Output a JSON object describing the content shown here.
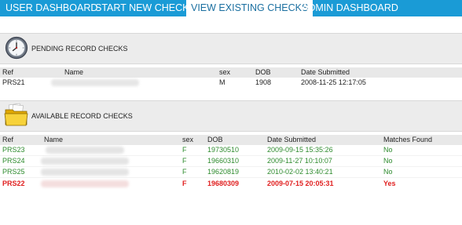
{
  "nav": {
    "tabs": [
      {
        "label": "USER DASHBOARD",
        "active": false
      },
      {
        "label": "START NEW CHECK",
        "active": false
      },
      {
        "label": "VIEW EXISTING CHECKS",
        "active": true
      },
      {
        "label": "ADMIN DASHBOARD",
        "active": false
      }
    ]
  },
  "pending": {
    "title": "PENDING RECORD CHECKS",
    "icon": "clock-icon",
    "columns": {
      "ref": "Ref",
      "name": "Name",
      "sex": "sex",
      "dob": "DOB",
      "date_submitted": "Date Submitted"
    },
    "rows": [
      {
        "ref": "PRS21",
        "sex": "M",
        "dob": "1908",
        "date_submitted": "2008-11-25 12:17:05"
      }
    ]
  },
  "available": {
    "title": "AVAILABLE RECORD CHECKS",
    "icon": "folder-icon",
    "columns": {
      "ref": "Ref",
      "name": "Name",
      "sex": "sex",
      "dob": "DOB",
      "date_submitted": "Date Submitted",
      "matches_found": "Matches Found"
    },
    "rows": [
      {
        "ref": "PRS23",
        "sex": "F",
        "dob": "19730510",
        "date_submitted": "2009-09-15 15:35:26",
        "matches_found": "No"
      },
      {
        "ref": "PRS24",
        "sex": "F",
        "dob": "19660310",
        "date_submitted": "2009-11-27 10:10:07",
        "matches_found": "No"
      },
      {
        "ref": "PRS25",
        "sex": "F",
        "dob": "19620819",
        "date_submitted": "2010-02-02 13:40:21",
        "matches_found": "No"
      },
      {
        "ref": "PRS22",
        "sex": "F",
        "dob": "19680309",
        "date_submitted": "2009-07-15 20:05:31",
        "matches_found": "Yes"
      }
    ]
  },
  "colors": {
    "nav_bg": "#1a9bd6",
    "match_no": "#2e8b2e",
    "match_yes": "#e02020"
  }
}
